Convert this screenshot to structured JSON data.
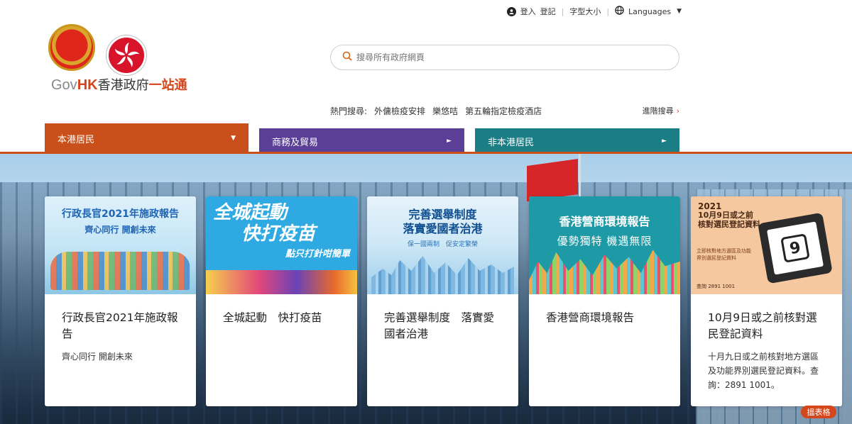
{
  "topbar": {
    "login": "登入",
    "register": "登記",
    "font_size": "字型大小",
    "languages": "Languages"
  },
  "logo": {
    "gov": "Gov",
    "hk": "HK",
    "zh": "香港政府",
    "one": "一站通"
  },
  "search": {
    "placeholder": "搜尋所有政府網頁"
  },
  "hot_search": {
    "label": "熱門搜尋:",
    "items": [
      "外傭檢疫安排",
      "樂悠咭",
      "第五輪指定檢疫酒店"
    ]
  },
  "advanced_search": "進階搜尋",
  "tabs": [
    {
      "label": "本港居民",
      "marker": "▼",
      "color": "#c9501a"
    },
    {
      "label": "商務及貿易",
      "marker": "►",
      "color": "#5b3f97"
    },
    {
      "label": "非本港居民",
      "marker": "►",
      "color": "#1b7e86"
    }
  ],
  "cards": [
    {
      "banner_title": "行政長官2021年施政報告",
      "banner_subtitle": "齊心同行 開創未來",
      "title": "行政長官2021年施政報告",
      "desc": "齊心同行 開創未來"
    },
    {
      "banner_line1": "全城起動",
      "banner_line2": "快打疫苗",
      "banner_line3": "點只打針咁簡單",
      "title": "全城起動　快打疫苗",
      "desc": ""
    },
    {
      "banner_line1": "完善選舉制度",
      "banner_line2": "落實愛國者治港",
      "banner_line3": "保一國兩制　促安定繁榮",
      "title": "完善選舉制度　落實愛國者治港",
      "desc": ""
    },
    {
      "banner_line1": "香港營商環境報告",
      "banner_line2": "優勢獨特 機遇無限",
      "title": "香港營商環境報告",
      "desc": ""
    },
    {
      "banner_year": "2021",
      "banner_line1": "10月9日或之前",
      "banner_line2": "核對選民登記資料",
      "banner_sub": "立即核對地方選區及功能界別選民登記資料",
      "banner_tel": "查詢 2891 1001",
      "banner_date": "9",
      "title": "10月9日或之前核對選民登記資料",
      "desc": "十月九日或之前核對地方選區及功能界別選民登記資料。查詢：2891 1001。"
    }
  ],
  "corner_tag": "搵表格"
}
